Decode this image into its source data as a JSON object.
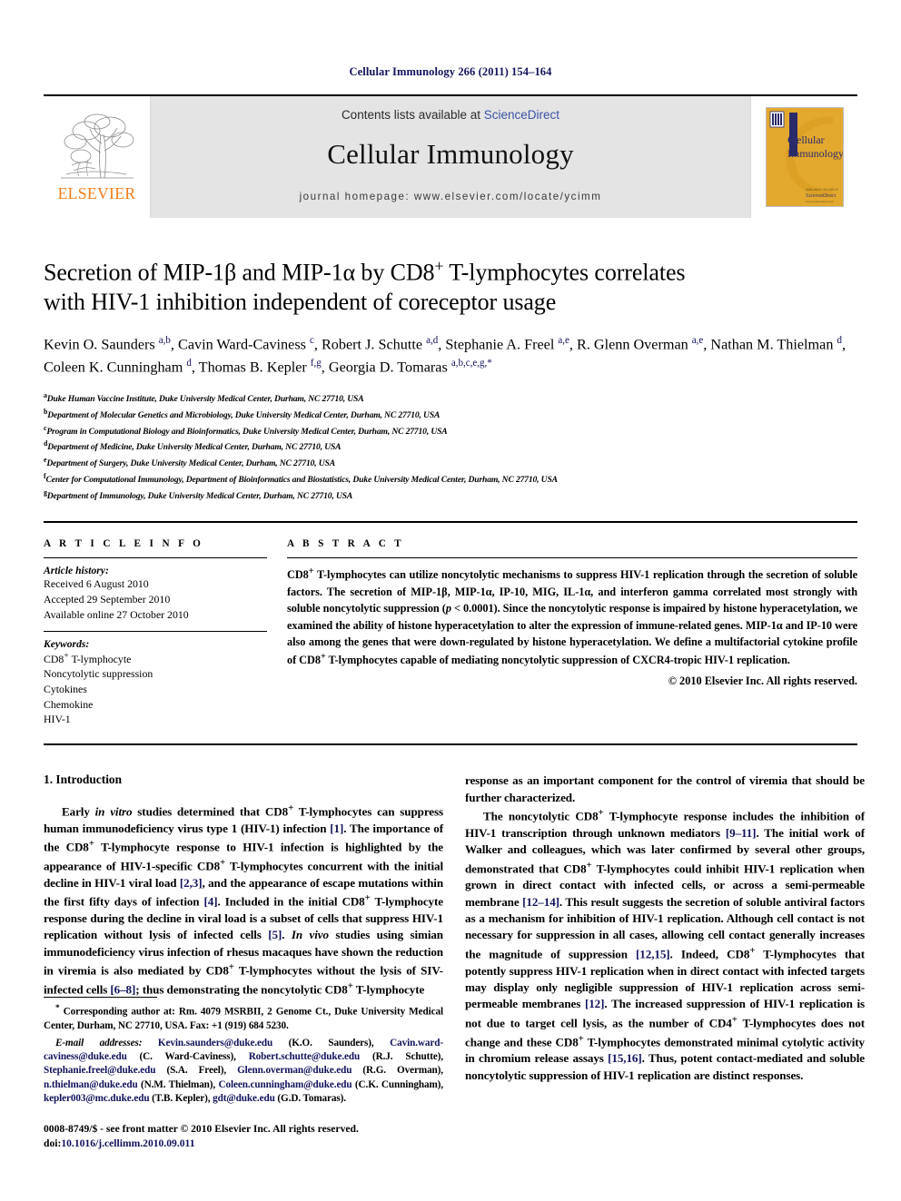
{
  "running_head": "Cellular Immunology 266 (2011) 154–164",
  "masthead": {
    "contents_prefix": "Contents lists available at ",
    "sciencedirect": "ScienceDirect",
    "journal_name": "Cellular Immunology",
    "homepage": "journal homepage: www.elsevier.com/locate/ycimm",
    "publisher_wordmark": "ELSEVIER",
    "cover_title_line1": "ellular",
    "cover_title_line2": "Immunology",
    "cover_initial": "C",
    "accent_orange": "#f07c1a",
    "accent_blue": "#3a53a4",
    "banner_gray": "#e4e4e4",
    "cover_gold": "#e3a92e",
    "cover_navy": "#2b2a6b"
  },
  "article": {
    "title_line1": "Secretion of MIP-1β and MIP-1α by CD8",
    "title_line1_sup": "+",
    "title_line1_rest": " T-lymphocytes correlates",
    "title_line2": "with HIV-1 inhibition independent of coreceptor usage",
    "authors_html": "Kevin O. Saunders <sup>a,b</sup>, Cavin Ward-Caviness <sup>c</sup>, Robert J. Schutte <sup>a,d</sup>, Stephanie A. Freel <sup>a,e</sup>, R. Glenn Overman <sup>a,e</sup>, Nathan M. Thielman <sup>d</sup>, Coleen K. Cunningham <sup>d</sup>, Thomas B. Kepler <sup>f,g</sup>, Georgia D. Tomaras <sup>a,b,c,e,g,</sup><sup>*</sup>",
    "affiliations": [
      {
        "marker": "a",
        "text": "Duke Human Vaccine Institute, Duke University Medical Center, Durham, NC 27710, USA"
      },
      {
        "marker": "b",
        "text": "Department of Molecular Genetics and Microbiology, Duke University Medical Center, Durham, NC 27710, USA"
      },
      {
        "marker": "c",
        "text": "Program in Computational Biology and Bioinformatics, Duke University Medical Center, Durham, NC 27710, USA"
      },
      {
        "marker": "d",
        "text": "Department of Medicine, Duke University Medical Center, Durham, NC 27710, USA"
      },
      {
        "marker": "e",
        "text": "Department of Surgery, Duke University Medical Center, Durham, NC 27710, USA"
      },
      {
        "marker": "f",
        "text": "Center for Computational Immunology, Department of Bioinformatics and Biostatistics, Duke University Medical Center, Durham, NC 27710, USA"
      },
      {
        "marker": "g",
        "text": "Department of Immunology, Duke University Medical Center, Durham, NC 27710, USA"
      }
    ]
  },
  "article_info": {
    "heading": "A R T I C L E    I N F O",
    "history_label": "Article history:",
    "history": [
      "Received 6 August 2010",
      "Accepted 29 September 2010",
      "Available online 27 October 2010"
    ],
    "keywords_label": "Keywords:",
    "keywords": [
      "CD8+ T-lymphocyte",
      "Noncytolytic suppression",
      "Cytokines",
      "Chemokine",
      "HIV-1"
    ]
  },
  "abstract": {
    "heading": "A B S T R A C T",
    "body_html": "CD8<sup>+</sup> T-lymphocytes can utilize noncytolytic mechanisms to suppress HIV-1 replication through the secretion of soluble factors. The secretion of MIP-1β, MIP-1α, IP-10, MIG, IL-1α, and interferon gamma correlated most strongly with soluble noncytolytic suppression (<span class=\"ital\">p</span> &lt; 0.0001). Since the noncytolytic response is impaired by histone hyperacetylation, we examined the ability of histone hyperacetylation to alter the expression of immune-related genes. MIP-1α and IP-10 were also among the genes that were down-regulated by histone hyperacetylation. We define a multifactorial cytokine profile of CD8<sup>+</sup> T-lymphocytes capable of mediating noncytolytic suppression of CXCR4-tropic HIV-1 replication.",
    "copyright": "© 2010 Elsevier Inc. All rights reserved."
  },
  "body": {
    "section_heading": "1. Introduction",
    "left_paragraphs_html": [
      "Early <span class=\"ital\">in vitro</span> studies determined that CD8<sup>+</sup> T-lymphocytes can suppress human immunodeficiency virus type 1 (HIV-1) infection <span class=\"cite\">[1]</span>. The importance of the CD8<sup>+</sup> T-lymphocyte response to HIV-1 infection is highlighted by the appearance of HIV-1-specific CD8<sup>+</sup> T-lymphocytes concurrent with the initial decline in HIV-1 viral load <span class=\"cite\">[2,3]</span>, and the appearance of escape mutations within the first fifty days of infection <span class=\"cite\">[4]</span>. Included in the initial CD8<sup>+</sup> T-lymphocyte response during the decline in viral load is a subset of cells that suppress HIV-1 replication without lysis of infected cells <span class=\"cite\">[5]</span>. <span class=\"ital\">In vivo</span> studies using simian immunodeficiency virus infection of rhesus macaques have shown the reduction in viremia is also mediated by CD8<sup>+</sup> T-lymphocytes without the lysis of SIV-infected cells <span class=\"cite\">[6–8]</span>; thus demonstrating the noncytolytic CD8<sup>+</sup> T-lymphocyte"
    ],
    "right_paragraphs_html": [
      "response as an important component for the control of viremia that should be further characterized.",
      "The noncytolytic CD8<sup>+</sup> T-lymphocyte response includes the inhibition of HIV-1 transcription through unknown mediators <span class=\"cite\">[9–11]</span>. The initial work of Walker and colleagues, which was later confirmed by several other groups, demonstrated that CD8<sup>+</sup> T-lymphocytes could inhibit HIV-1 replication when grown in direct contact with infected cells, or across a semi-permeable membrane <span class=\"cite\">[12–14]</span>. This result suggests the secretion of soluble antiviral factors as a mechanism for inhibition of HIV-1 replication. Although cell contact is not necessary for suppression in all cases, allowing cell contact generally increases the magnitude of suppression <span class=\"cite\">[12,15]</span>. Indeed, CD8<sup>+</sup> T-lymphocytes that potently suppress HIV-1 replication when in direct contact with infected targets may display only negligible suppression of HIV-1 replication across semi-permeable membranes <span class=\"cite\">[12]</span>. The increased suppression of HIV-1 replication is not due to target cell lysis, as the number of CD4<sup>+</sup> T-lymphocytes does not change and these CD8<sup>+</sup> T-lymphocytes demonstrated minimal cytolytic activity in chromium release assays <span class=\"cite\">[15,16]</span>. Thus, potent contact-mediated and soluble noncytolytic suppression of HIV-1 replication are distinct responses."
    ]
  },
  "footnote": {
    "corresponding_html": "<sup>*</sup> Corresponding author at: Rm. 4079 MSRBII, 2 Genome Ct., Duke University Medical Center, Durham, NC 27710, USA. Fax: +1 (919) 684 5230.",
    "emails_html": "<span class=\"mail-label\">E-mail addresses:</span> <span class=\"mail\">Kevin.saunders@duke.edu</span> (K.O. Saunders), <span class=\"mail\">Cavin.ward-caviness@duke.edu</span> (C. Ward-Caviness), <span class=\"mail\">Robert.schutte@duke.edu</span> (R.J. Schutte), <span class=\"mail\">Stephanie.freel@duke.edu</span> (S.A. Freel), <span class=\"mail\">Glenn.overman@duke.edu</span> (R.G. Overman), <span class=\"mail\">n.thielman@duke.edu</span> (N.M. Thielman), <span class=\"mail\">Coleen.cunningham@duke.edu</span> (C.K. Cunningham), <span class=\"mail\">kepler003@mc.duke.edu</span> (T.B. Kepler), <span class=\"mail\">gdt@duke.edu</span> (G.D. Tomaras)."
  },
  "footer": {
    "issn_line": "0008-8749/$ - see front matter © 2010 Elsevier Inc. All rights reserved.",
    "doi_prefix": "doi:",
    "doi_value": "10.1016/j.cellimm.2010.09.011"
  }
}
